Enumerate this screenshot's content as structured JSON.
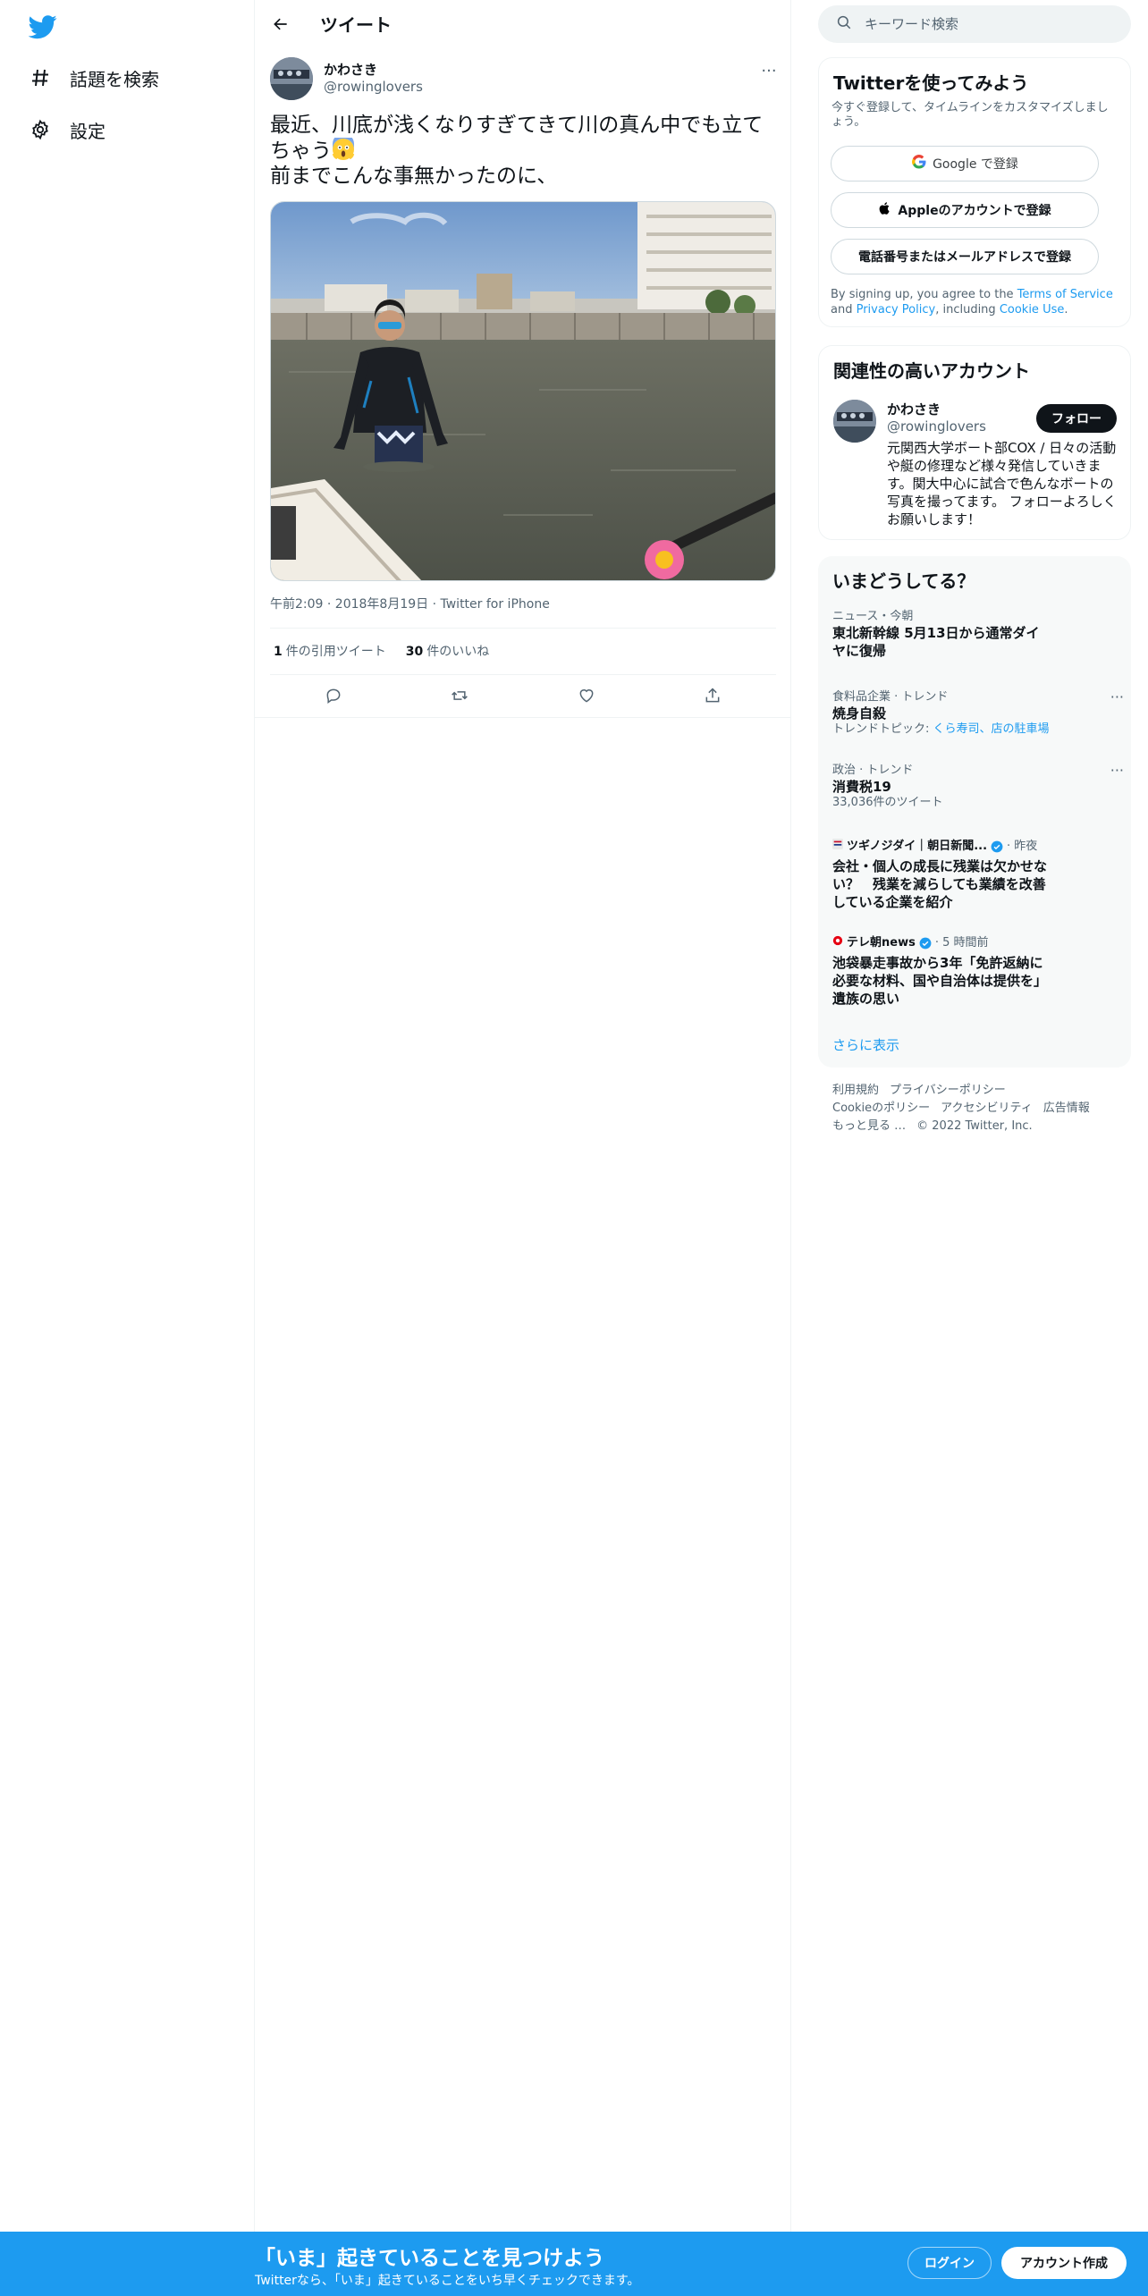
{
  "nav": {
    "logo_icon": "twitter-bird-icon",
    "items": [
      {
        "label": "話題を検索",
        "icon": "hashtag-icon"
      },
      {
        "label": "設定",
        "icon": "gear-icon"
      }
    ]
  },
  "header": {
    "title": "ツイート"
  },
  "tweet": {
    "author_name": "かわさき",
    "author_handle": "@rowinglovers",
    "text_line1": "最近、川底が浅くなりすぎてきて川の真ん中でも立て",
    "text_line2": "ちゃう",
    "text_line3": "前までこんな事無かったのに、",
    "meta": "午前2:09 · 2018年8月19日 · Twitter for iPhone",
    "quote_count": "1",
    "quote_label": "件の引用ツイート",
    "like_count": "30",
    "like_label": "件のいいね"
  },
  "search": {
    "placeholder": "キーワード検索"
  },
  "signup_card": {
    "title": "Twitterを使ってみよう",
    "subtitle": "今すぐ登録して、タイムラインをカスタマイズしましょう。",
    "google_label": "Google で登録",
    "apple_label": "Appleのアカウントで登録",
    "phone_label": "電話番号またはメールアドレスで登録",
    "terms_prefix": "By signing up, you agree to the ",
    "terms_link": "Terms of Service",
    "terms_and": " and ",
    "privacy_link": "Privacy Policy",
    "terms_including": ", including ",
    "cookie_link": "Cookie Use",
    "terms_end": "."
  },
  "related_card": {
    "title": "関連性の高いアカウント",
    "name": "かわさき",
    "handle": "@rowinglovers",
    "follow_label": "フォロー",
    "bio": "元関西大学ボート部COX / 日々の活動や艇の修理など様々発信していきます。関大中心に試合で色んなボートの写真を撮ってます。 フォローよろしくお願いします！"
  },
  "trends_card": {
    "title": "いまどうしてる？",
    "items": [
      {
        "context": "ニュース・今朝",
        "name": "東北新幹線 5月13日から通常ダイヤに復帰"
      },
      {
        "context": "食料品企業 · トレンド",
        "name": "焼身自殺",
        "topic_prefix": "トレンドトピック: ",
        "topic_link": "くら寿司、店の駐車場"
      },
      {
        "context": "政治 · トレンド",
        "name": "消費税19",
        "sub": "33,036件のツイート"
      }
    ],
    "news": [
      {
        "source": "ツギノジダイ｜朝日新聞...",
        "time": "· 昨夜",
        "headline": "会社・個人の成長に残業は欠かせない？　残業を減らしても業績を改善している企業を紹介"
      },
      {
        "source": "テレ朝news",
        "time": "· 5 時間前",
        "headline": "池袋暴走事故から3年「免許返納に必要な材料、国や自治体は提供を」　遺族の思い"
      }
    ],
    "show_more": "さらに表示"
  },
  "footer": {
    "links": [
      "利用規約",
      "プライバシーポリシー",
      "Cookieのポリシー",
      "アクセシビリティ",
      "広告情報",
      "もっと見る …"
    ],
    "copyright": "© 2022 Twitter, Inc."
  },
  "bottom_bar": {
    "title": "「いま」起きていることを見つけよう",
    "subtitle": "Twitterなら、「いま」起きていることをいち早くチェックできます。",
    "login_label": "ログイン",
    "signup_label": "アカウント作成"
  },
  "colors": {
    "accent": "#1d9bf0",
    "text": "#0f1419",
    "muted": "#536471",
    "border": "#eff3f4"
  }
}
